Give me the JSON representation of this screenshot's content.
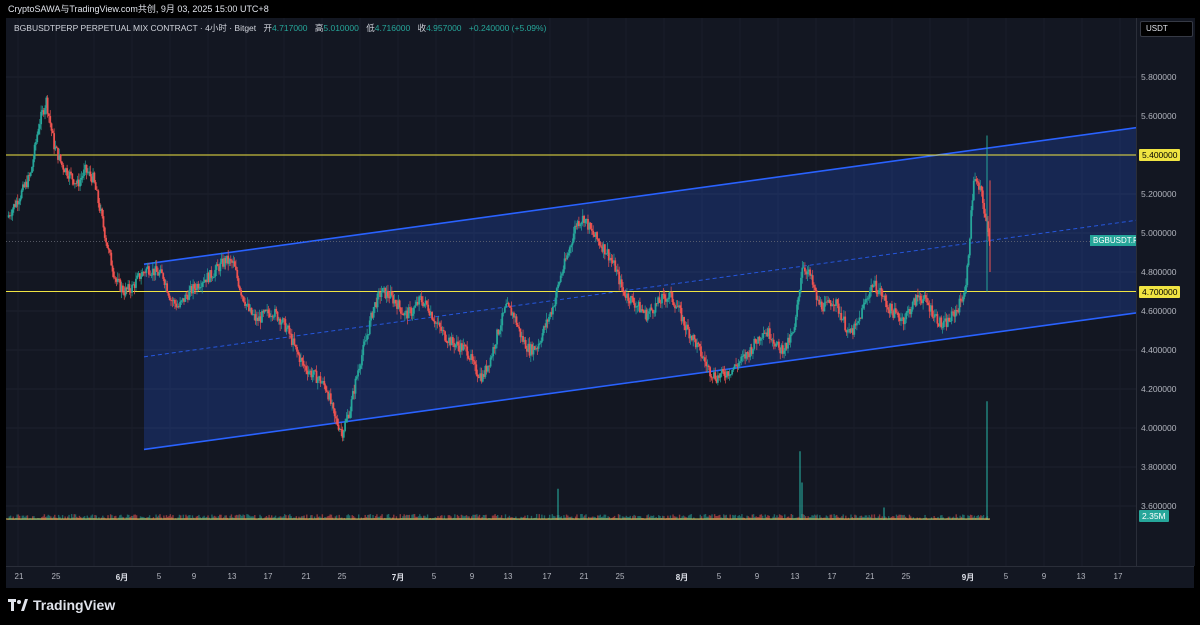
{
  "header": {
    "attribution": "CryptoSAWA与TradingView.com共创, 9月 03, 2025 15:00 UTC+8"
  },
  "legend": {
    "symbol": "BGBUSDTPERP PERPETUAL MIX CONTRACT · 4小时 · Bitget",
    "open_label": "开",
    "open": "4.717000",
    "high_label": "高",
    "high": "5.010000",
    "low_label": "低",
    "low": "4.716000",
    "close_label": "收",
    "close": "4.957000",
    "change": "+0.240000 (+5.09%)"
  },
  "price_scale": {
    "currency": "USDT",
    "labels": [
      "5.800000",
      "5.600000",
      "5.200000",
      "5.000000",
      "4.800000",
      "4.600000",
      "4.400000",
      "4.200000",
      "4.000000",
      "3.800000",
      "3.600000"
    ],
    "resistance_tag": "5.400000",
    "support_tag": "4.700000",
    "symbol_tag": "BGBUSDT.P",
    "volume_tag": "2.35M"
  },
  "time_axis": {
    "ticks": [
      "21",
      "25",
      "6月",
      "5",
      "9",
      "13",
      "17",
      "21",
      "25",
      "7月",
      "5",
      "9",
      "13",
      "17",
      "21",
      "25",
      "8月",
      "5",
      "9",
      "13",
      "17",
      "21",
      "25",
      "9月",
      "5",
      "9",
      "13",
      "17"
    ]
  },
  "colors": {
    "background": "#131722",
    "up": "#26a69a",
    "down": "#ef5350",
    "channel": "#2962ff",
    "horizontal_lines": "#f0e442"
  },
  "branding": {
    "logo_icon": "tradingview-logo-icon",
    "logo_text": "TradingView"
  },
  "chart_data": {
    "type": "candlestick",
    "price_range": [
      3.5,
      5.9
    ],
    "horizontal_levels": [
      5.4,
      4.7
    ],
    "channel": {
      "upper_start": 4.84,
      "upper_end": 5.54,
      "lower_start": 3.89,
      "lower_end": 4.59,
      "mid_start": 4.365,
      "mid_end": 5.065
    },
    "close_path": [
      5.08,
      5.15,
      5.22,
      5.3,
      5.55,
      5.68,
      5.45,
      5.35,
      5.3,
      5.25,
      5.32,
      5.28,
      5.1,
      4.9,
      4.75,
      4.7,
      4.72,
      4.78,
      4.82,
      4.8,
      4.78,
      4.66,
      4.62,
      4.68,
      4.72,
      4.76,
      4.78,
      4.82,
      4.86,
      4.84,
      4.7,
      4.6,
      4.55,
      4.58,
      4.6,
      4.56,
      4.5,
      4.4,
      4.32,
      4.28,
      4.25,
      4.2,
      4.05,
      3.98,
      4.1,
      4.3,
      4.45,
      4.62,
      4.7,
      4.68,
      4.64,
      4.58,
      4.6,
      4.66,
      4.62,
      4.54,
      4.48,
      4.44,
      4.42,
      4.4,
      4.3,
      4.26,
      4.36,
      4.5,
      4.62,
      4.58,
      4.46,
      4.4,
      4.42,
      4.52,
      4.62,
      4.78,
      4.9,
      5.05,
      5.08,
      5.0,
      4.95,
      4.9,
      4.82,
      4.7,
      4.66,
      4.62,
      4.58,
      4.62,
      4.66,
      4.68,
      4.62,
      4.52,
      4.46,
      4.38,
      4.3,
      4.26,
      4.28,
      4.3,
      4.34,
      4.38,
      4.44,
      4.5,
      4.48,
      4.4,
      4.42,
      4.5,
      4.84,
      4.78,
      4.64,
      4.62,
      4.66,
      4.58,
      4.48,
      4.52,
      4.64,
      4.74,
      4.7,
      4.62,
      4.58,
      4.56,
      4.62,
      4.68,
      4.64,
      4.58,
      4.52,
      4.56,
      4.62,
      4.72,
      5.28,
      5.2,
      4.957
    ],
    "volume_spikes": [
      0.25,
      0.55,
      0.1,
      0.95,
      0.3
    ]
  }
}
